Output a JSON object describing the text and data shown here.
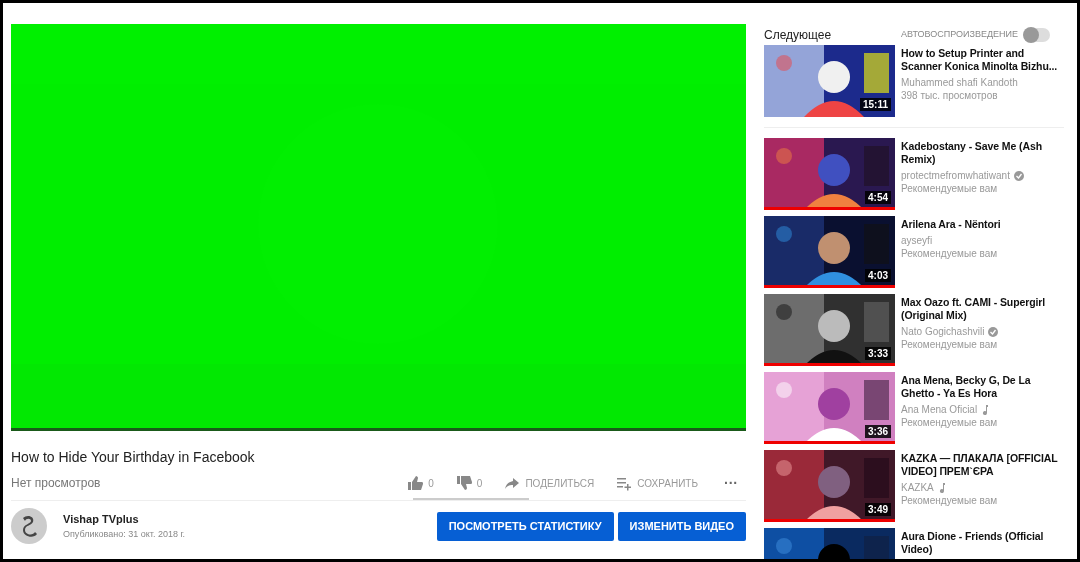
{
  "video": {
    "kind": "picture",
    "title": "How to Hide Your Birthday in Facebook",
    "views": "Нет просмотров"
  },
  "actions": [
    {
      "kind": "like",
      "label": "0"
    },
    {
      "kind": "dislike",
      "label": "0"
    },
    {
      "kind": "share",
      "label": "ПОДЕЛИТЬСЯ"
    },
    {
      "kind": "save",
      "label": "СОХРАНИТЬ"
    },
    {
      "kind": "more",
      "label": "···"
    }
  ],
  "channel": {
    "name": "Vishap TVplus",
    "published": "Опубликовано: 31 окт. 2018 г."
  },
  "buttons": [
    "ПОСМОТРЕТЬ СТАТИСТИКУ",
    "ИЗМЕНИТЬ ВИДЕО"
  ],
  "sidebar": {
    "heading": "Следующее",
    "autoplay_label": "АВТОВОСПРОИЗВЕДЕНИЕ",
    "autoplay_on": false,
    "items": [
      {
        "title": "How to Setup Printer and Scanner Konica Minolta Bizhu...",
        "channel": "Muhammed shafi Kandoth",
        "meta": "398 тыс. просмотров",
        "duration": "15:11"
      },
      {
        "title": "Kadebostany - Save Me (Ash Remix)",
        "channel": "protectmefromwhatiwant",
        "verified": true,
        "meta": "Рекомендуемые вам",
        "duration": "4:54",
        "level": 1
      },
      {
        "title": "Arilena Ara - Nëntori",
        "channel": "ayseyfi",
        "meta": "Рекомендуемые вам",
        "duration": "4:03",
        "level": 1
      },
      {
        "title": "Max Oazo ft. CAMI - Supergirl (Original Mix)",
        "channel": "Nato Gogichashvili",
        "verified": true,
        "meta": "Рекомендуемые вам",
        "duration": "3:33",
        "level": 1
      },
      {
        "title": "Ana Mena, Becky G, De La Ghetto - Ya Es Hora",
        "channel": "Ana Mena Oficial",
        "music": true,
        "meta": "Рекомендуемые вам",
        "duration": "3:36",
        "level": 1
      },
      {
        "title": "KAZKA — ПЛАКАЛА [OFFICIAL VIDEO] ПРЕМ`ЄРА",
        "channel": "KAZKA",
        "music": true,
        "meta": "Рекомендуемые вам",
        "duration": "3:49",
        "level": 1
      },
      {
        "title": "Aura Dione - Friends (Official Video)"
      }
    ]
  }
}
